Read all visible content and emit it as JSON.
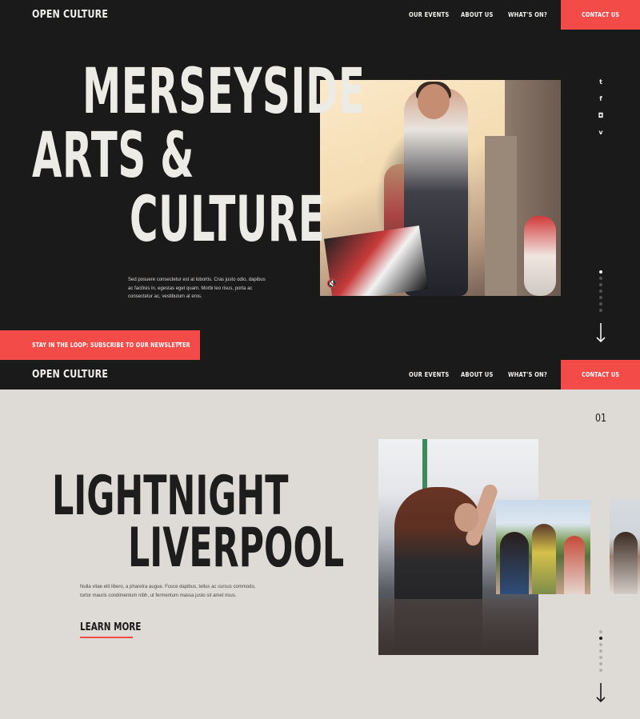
{
  "colors": {
    "accent": "#f24b48",
    "dark_bg": "#1b1a1a",
    "light_bg": "#dedbd6",
    "light_text": "#f2f0ec"
  },
  "nav": {
    "logo": "OPEN CULTURE",
    "links": [
      "OUR EVENTS",
      "ABOUT US",
      "WHAT'S ON?"
    ],
    "contact": "CONTACT US"
  },
  "hero": {
    "title_lines": [
      "MERSEYSIDE",
      "ARTS &",
      "CULTURE"
    ],
    "description": "Sed posuere consectetur est at lobortis. Cras justo odio, dapibus ac facilisis in, egestas eget quam. Morbi leo risus, porta ac consectetur ac, vestibulum at eros.",
    "newsletter": "STAY IN THE LOOP: SUBSCRIBE TO OUR NEWSLETTER",
    "social_icons": [
      "twitter-icon",
      "facebook-icon",
      "instagram-icon",
      "vimeo-icon"
    ],
    "social_glyphs": [
      "t",
      "f",
      "◘",
      "v"
    ],
    "mute_glyph": "🔇",
    "pager_dots": 7,
    "active_dot": 0
  },
  "second": {
    "slide_number": "01",
    "title_lines": [
      "LIGHTNIGHT",
      "LIVERPOOL"
    ],
    "description": "Nulla vitae elit libero, a pharetra augue. Fusce dapibus, tellus ac cursus commodo, tortor mauris condimentum nibh, ut fermentum massa justo sit amet risus.",
    "cta": "LEARN MORE",
    "prev_glyph": "‹",
    "next_glyph": "›",
    "pager_dots": 7,
    "active_dot": 1
  }
}
